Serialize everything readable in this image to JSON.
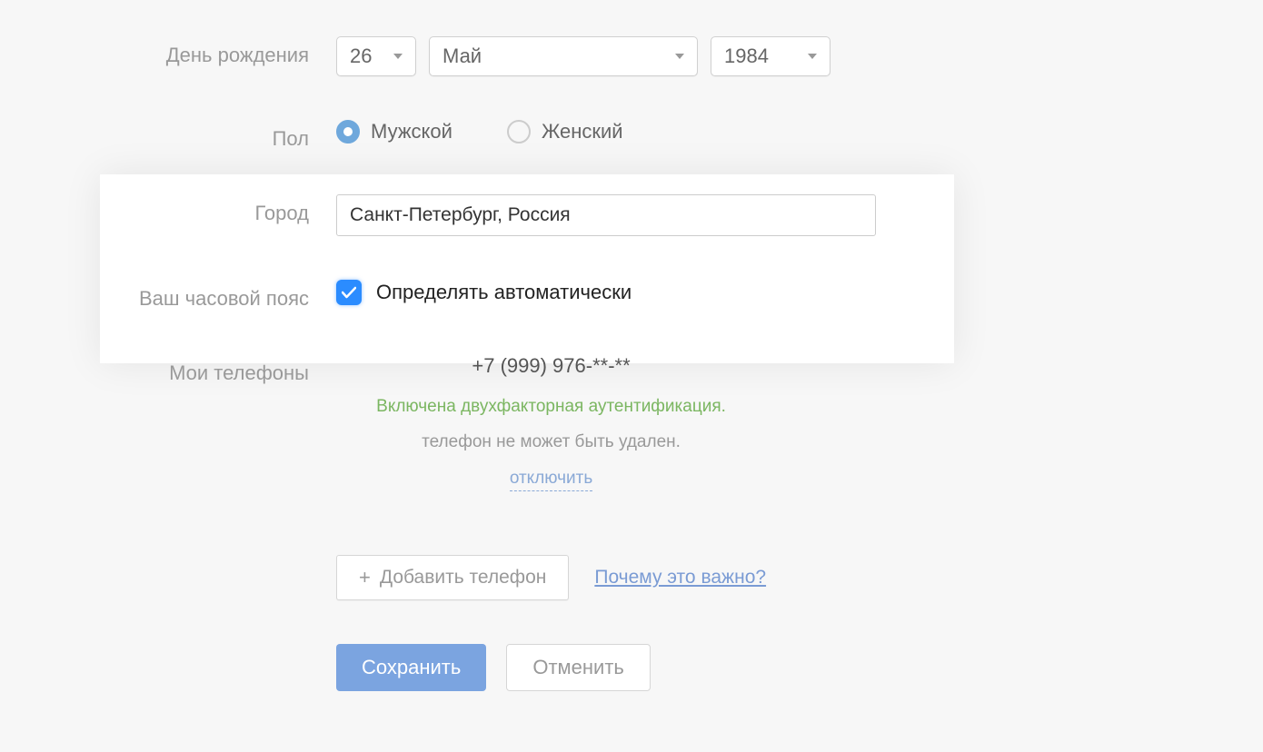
{
  "labels": {
    "birthday": "День рождения",
    "gender": "Пол",
    "city": "Город",
    "timezone": "Ваш часовой пояс",
    "phones": "Мои телефоны"
  },
  "birthday": {
    "day": "26",
    "month": "Май",
    "year": "1984"
  },
  "gender": {
    "male": "Мужской",
    "female": "Женский"
  },
  "city_value": "Санкт-Петербург, Россия",
  "timezone_auto": "Определять автоматически",
  "phone": {
    "number": "+7 (999) 976-**-**",
    "status": "Включена двухфакторная аутентификация.",
    "hint": "телефон не может быть удален.",
    "disable": "отключить"
  },
  "add_phone": "Добавить телефон",
  "why_important": "Почему это важно?",
  "actions": {
    "save": "Сохранить",
    "cancel": "Отменить"
  }
}
